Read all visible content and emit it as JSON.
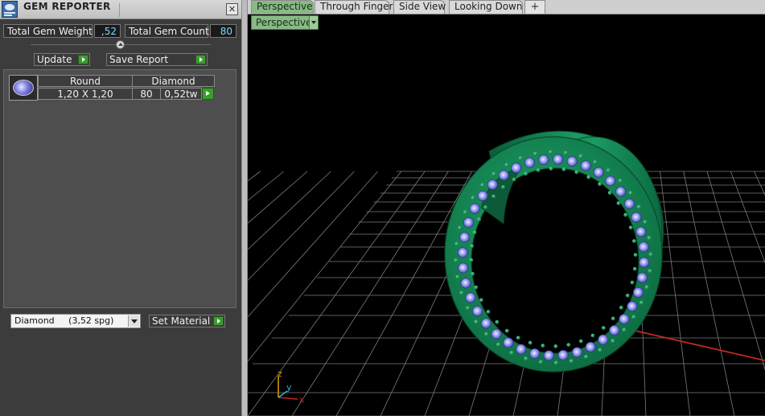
{
  "panel": {
    "title": "GEM REPORTER",
    "close_symbol": "✕",
    "total_weight_label": "Total Gem Weight",
    "total_weight_value": ",52",
    "total_count_label": "Total Gem Count",
    "total_count_value": "80",
    "update_label": "Update",
    "save_report_label": "Save Report",
    "gems": [
      {
        "shape": "Round",
        "material": "Diamond",
        "size": "1,20 X 1,20",
        "count": "80",
        "weight": "0,52tw"
      }
    ],
    "material_select_value": "Diamond     (3,52 spg)",
    "set_material_label": "Set Material"
  },
  "viewport": {
    "tabs": [
      "Perspective",
      "Through Finger",
      "Side View",
      "Looking Down"
    ],
    "add_tab_symbol": "+",
    "view_mode": "Perspective",
    "axis_labels": {
      "z": "z",
      "y": "y",
      "x": "x"
    }
  },
  "icons": {
    "app_logo": "gem-reporter-logo-icon",
    "close": "close-icon",
    "go": "play-arrow-icon",
    "dropdown": "chevron-down-icon",
    "gem_thumb": "round-gem-icon"
  },
  "colors": {
    "ring_green": "#0f7a4c",
    "gem_blue": "#7f86e8",
    "tab_active": "#8ab987",
    "value_text": "#7fd8ff",
    "axis_x": "#c0281e",
    "axis_y": "#2bb7c9",
    "axis_z": "#e2a000"
  }
}
